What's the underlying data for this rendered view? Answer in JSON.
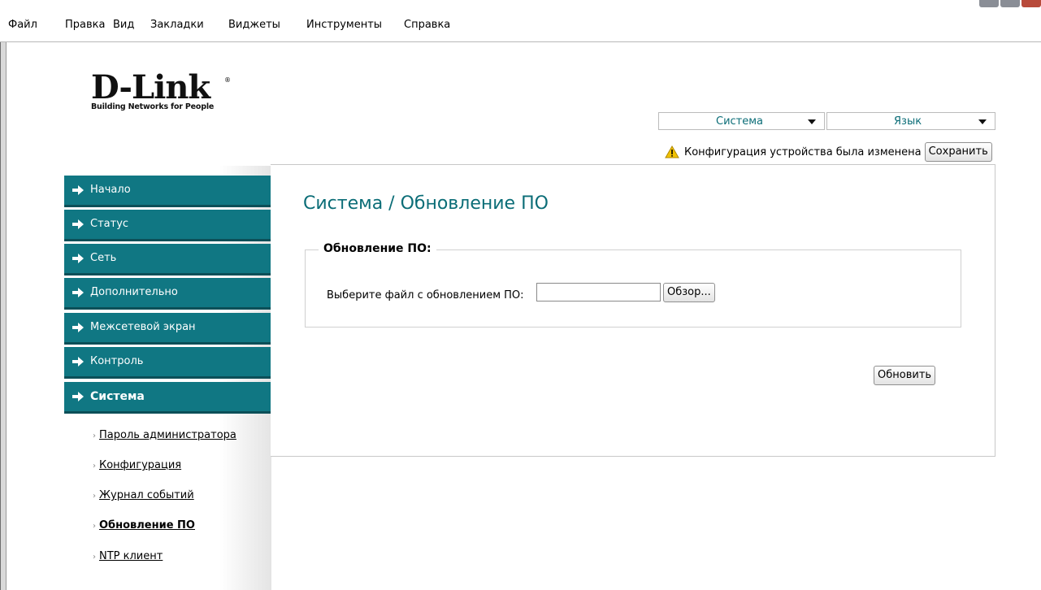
{
  "menubar": {
    "items": [
      "Файл",
      "Правка",
      "Вид",
      "Закладки",
      "Виджеты",
      "Инструменты",
      "Справка"
    ]
  },
  "logo": {
    "brand": "D-Link",
    "registered": "®",
    "tagline": "Building Networks for People"
  },
  "header": {
    "system_dropdown": "Система",
    "language_dropdown": "Язык",
    "notice_text": "Конфигурация устройства была изменена",
    "save_label": "Сохранить"
  },
  "sidebar": {
    "items": [
      {
        "label": "Начало"
      },
      {
        "label": "Статус"
      },
      {
        "label": "Сеть"
      },
      {
        "label": "Дополнительно"
      },
      {
        "label": "Межсетевой экран"
      },
      {
        "label": "Контроль"
      },
      {
        "label": "Система",
        "active": true
      }
    ],
    "subitems": [
      {
        "label": "Пароль администратора"
      },
      {
        "label": "Конфигурация"
      },
      {
        "label": "Журнал событий"
      },
      {
        "label": "Обновление ПО",
        "active": true
      },
      {
        "label": "NTP клиент"
      }
    ]
  },
  "main": {
    "title": "Система /  Обновление ПО",
    "section_legend": "Обновление ПО:",
    "file_label": "Выберите файл с обновлением ПО:",
    "file_value": "",
    "browse_label": "Обзор...",
    "update_label": "Обновить"
  },
  "colors": {
    "accent": "#107783",
    "accent_text": "#0b6d77",
    "warning": "#f2c200"
  }
}
